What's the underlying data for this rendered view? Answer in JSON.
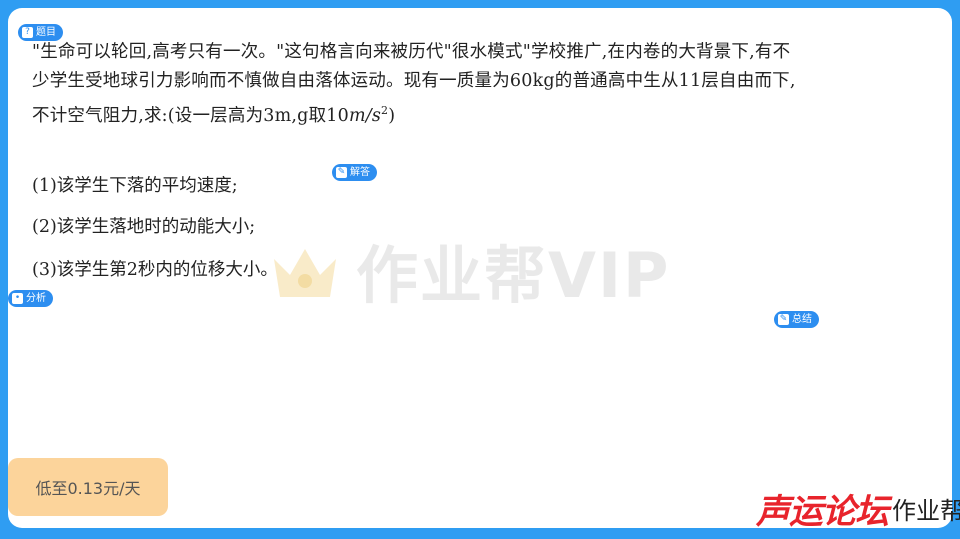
{
  "tags": {
    "question": "题目",
    "answer": "解答",
    "analysis": "分析",
    "summary": "总结"
  },
  "question": {
    "line1": "\"生命可以轮回,高考只有一次。\"这句格言向来被历代\"很水模式\"学校推广,在内卷的大背景下,有不",
    "line2": "少学生受地球引力影响而不慎做自由落体运动。现有一质量为60kg的普通高中生从11层自由而下,",
    "line3_prefix": "不计空气阻力,求:(设一层高为3m,g取10",
    "line3_unit": "m/s",
    "line3_exp": "2",
    "line3_suffix": ")"
  },
  "sub_questions": [
    "(1)该学生下落的平均速度;",
    "(2)该学生落地时的动能大小;",
    "(3)该学生第2秒内的位移大小。"
  ],
  "watermark": "作业帮VIP",
  "price_button": "低至0.13元/天",
  "bottom_logo": {
    "forum": "声运论坛",
    "brand": "作业帮VIP"
  },
  "colors": {
    "frame": "#2f9df2",
    "tag": "#2d8ef0",
    "price_bg": "#fcd49b",
    "forum_red": "#e8242c"
  }
}
